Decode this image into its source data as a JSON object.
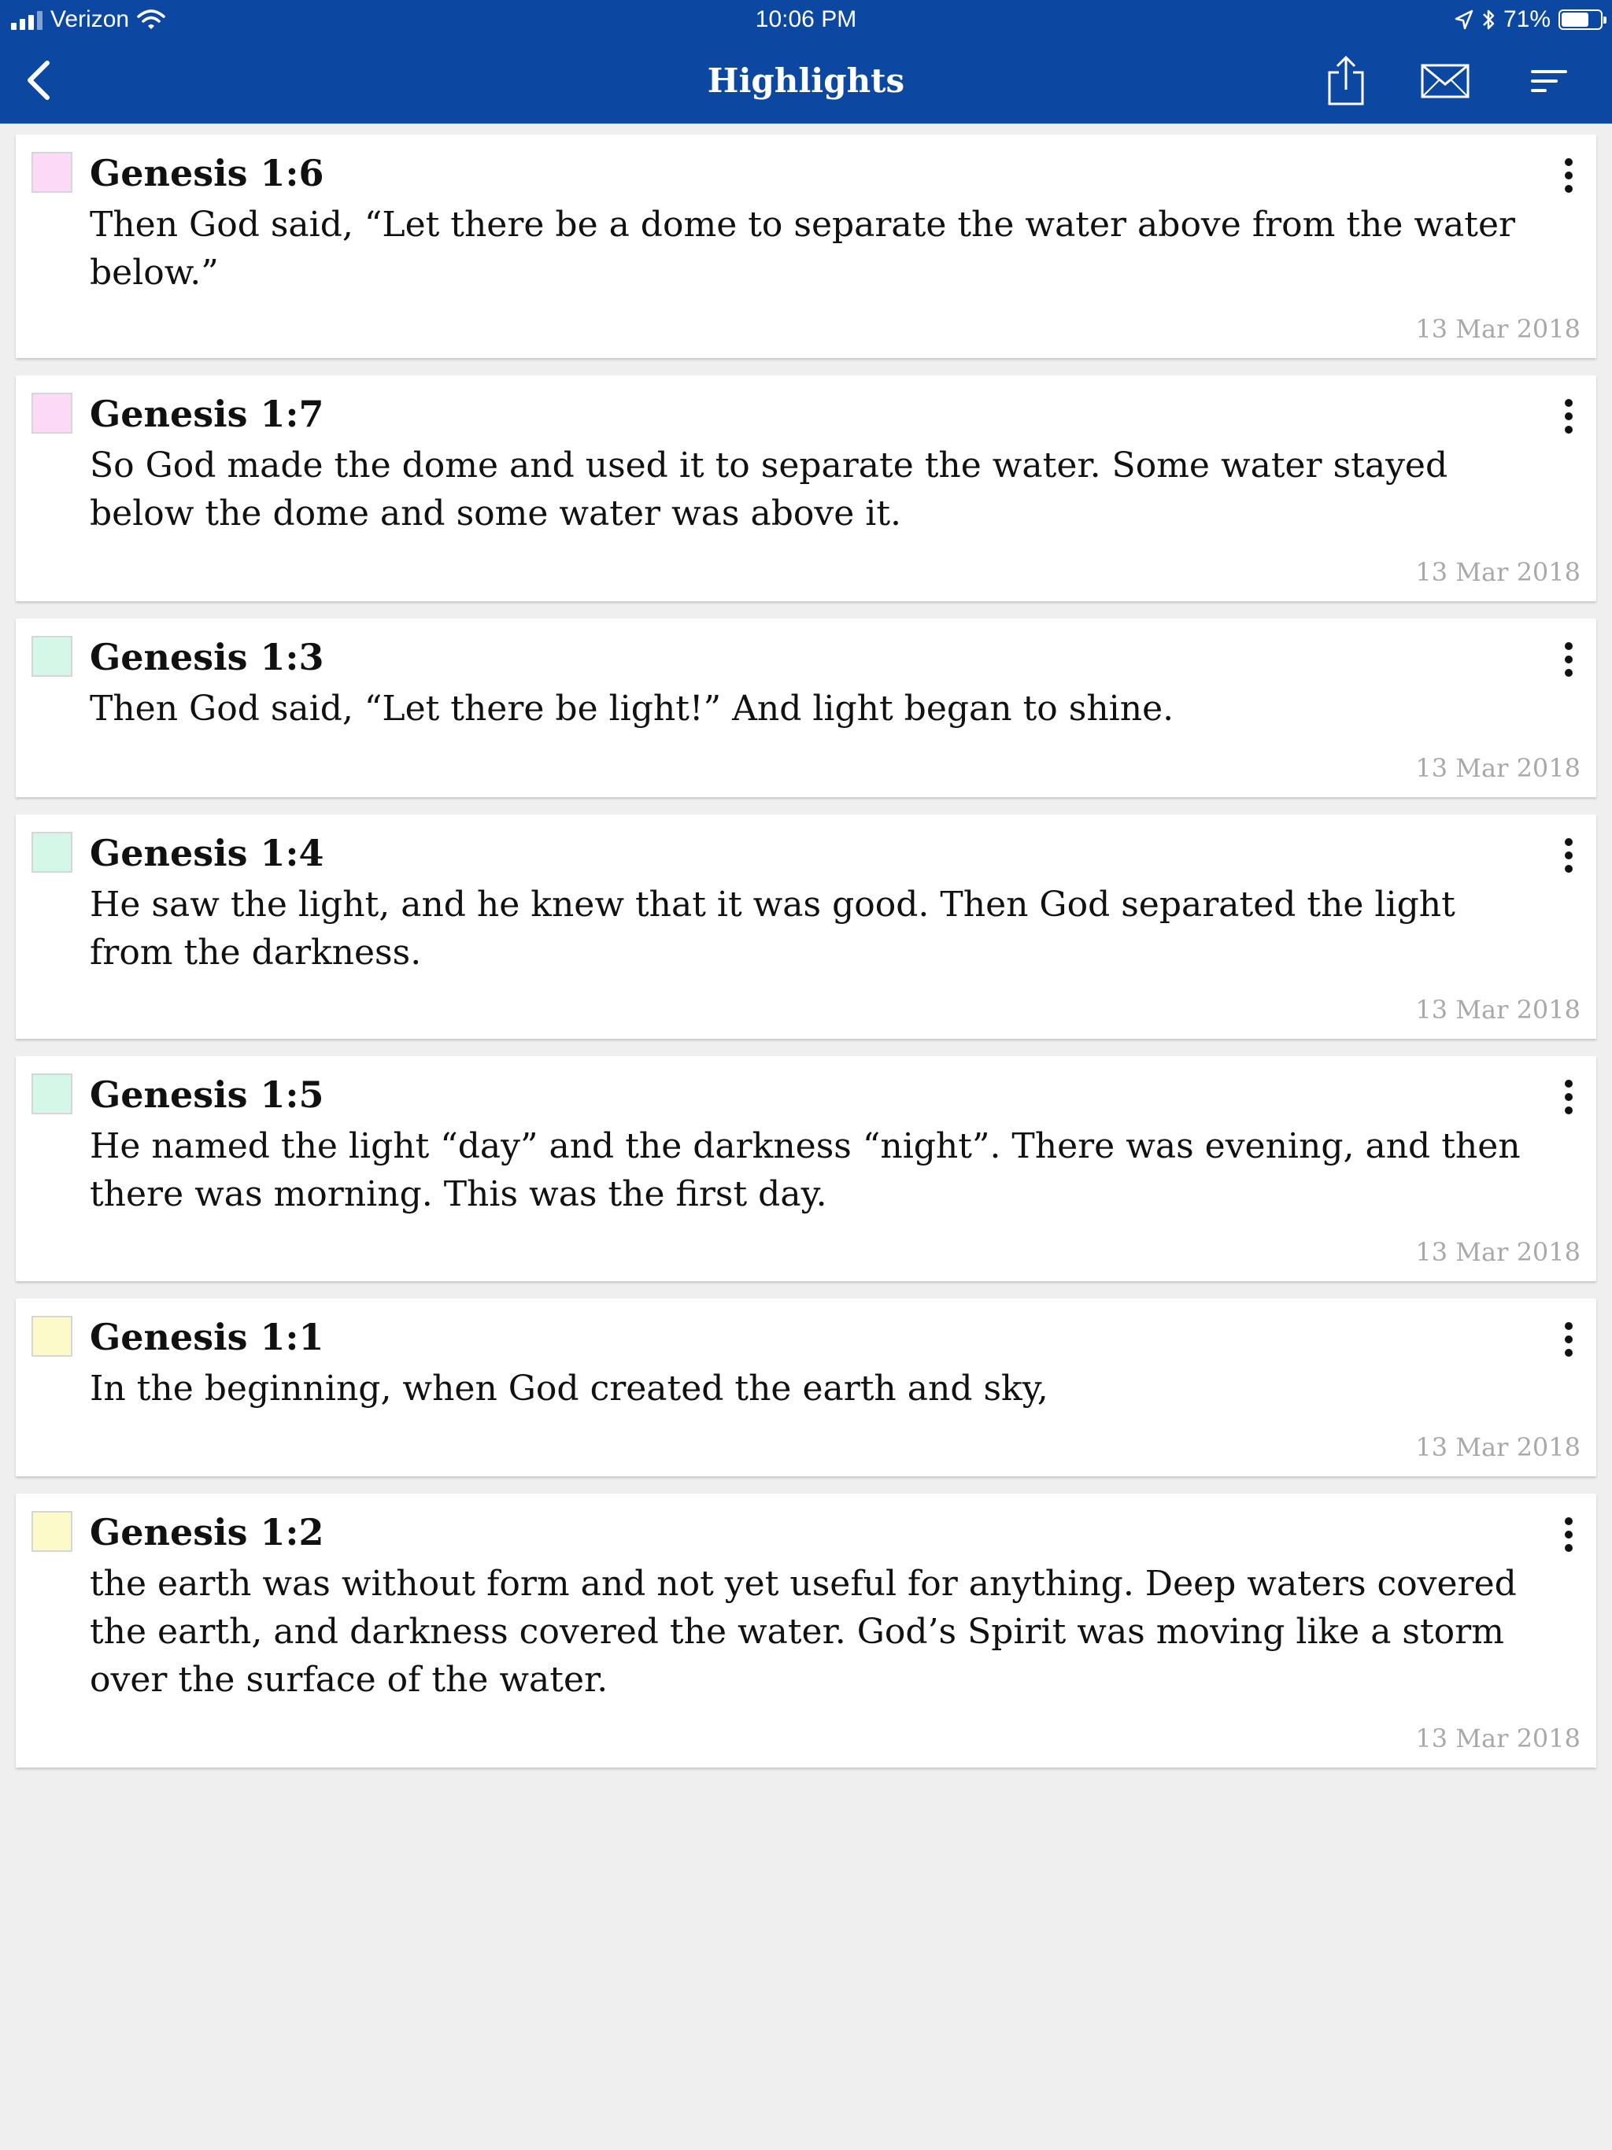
{
  "status_bar": {
    "carrier": "Verizon",
    "time": "10:06 PM",
    "battery": "71%",
    "battery_level": 0.71
  },
  "nav": {
    "title": "Highlights",
    "back_icon": "chevron-left-icon",
    "share_icon": "share-icon",
    "mail_icon": "mail-icon",
    "sort_icon": "sort-icon"
  },
  "highlights": [
    {
      "ref": "Genesis 1:6",
      "text": "Then God said, “Let there be a dome to separate the water above from the water below.”",
      "date": "13 Mar 2018",
      "color": "#fcd9f6"
    },
    {
      "ref": "Genesis 1:7",
      "text": "So God made the dome and used it to separate the water. Some water stayed below the dome and some water was above it.",
      "date": "13 Mar 2018",
      "color": "#fcd9f6"
    },
    {
      "ref": "Genesis 1:3",
      "text": "Then God said, “Let there be light!” And light began to shine.",
      "date": "13 Mar 2018",
      "color": "#d4f7e7"
    },
    {
      "ref": "Genesis 1:4",
      "text": "He saw the light, and he knew that it was good. Then God separated the light from the darkness.",
      "date": "13 Mar 2018",
      "color": "#d4f7e7"
    },
    {
      "ref": "Genesis 1:5",
      "text": "He named the light “day” and the darkness “night”. There was evening, and then there was morning. This was the first day.",
      "date": "13 Mar 2018",
      "color": "#d4f7e7"
    },
    {
      "ref": "Genesis 1:1",
      "text": "In the beginning, when God created the earth and sky,",
      "date": "13 Mar 2018",
      "color": "#fdfac9"
    },
    {
      "ref": "Genesis 1:2",
      "text": "the earth was without form and not yet useful for anything. Deep waters covered the earth, and darkness covered the water. God’s Spirit was moving like a storm over the surface of the water.",
      "date": "13 Mar 2018",
      "color": "#fdfac9"
    }
  ]
}
